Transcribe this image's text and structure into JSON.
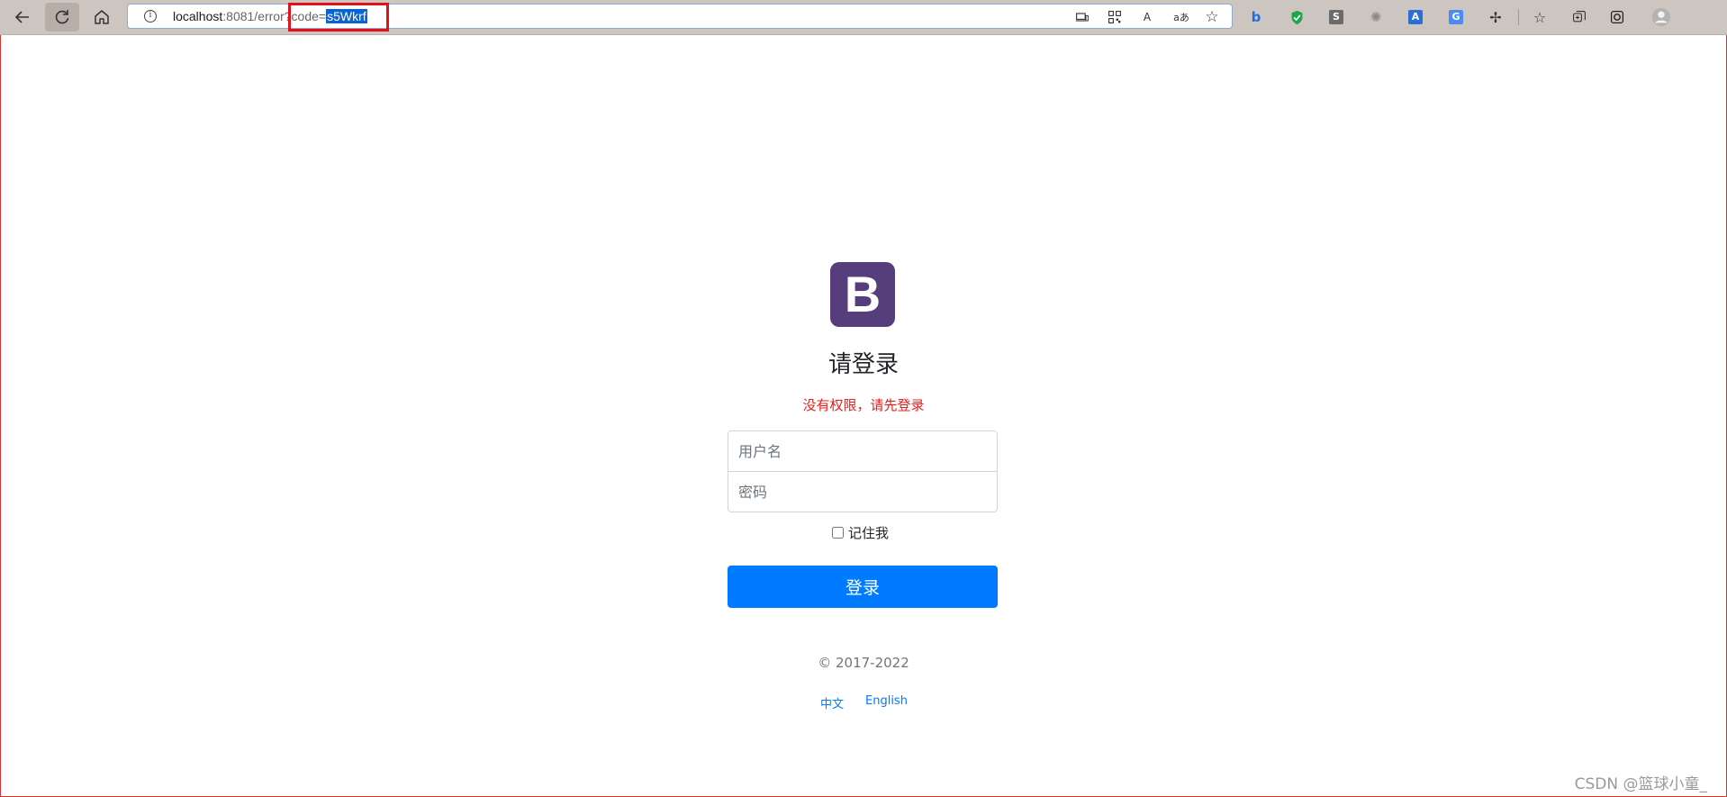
{
  "browser": {
    "url_host": "localhost",
    "url_path": ":8081/error?",
    "url_param": "code=",
    "url_selected": "s5Wkrf",
    "info_glyph": "i",
    "toolbar_icons": [
      "back-icon",
      "refresh-icon",
      "home-icon"
    ],
    "addressbar_icons": [
      "app-available-icon",
      "qr-code-icon",
      "read-aloud-icon",
      "translate-icon",
      "add-favorite-icon"
    ],
    "read_aloud_glyph": "A",
    "translate_glyph": "aあ",
    "extensions": [
      {
        "name": "bing-icon",
        "glyph": "b",
        "color": "#1b6ee5"
      },
      {
        "name": "shield-extension-icon",
        "glyph": "✓",
        "color": "#1aa84a"
      },
      {
        "name": "s-extension-icon",
        "glyph": "S",
        "color": "#6b6b6b"
      },
      {
        "name": "gear-extension-icon",
        "glyph": "✺",
        "color": "#8a8a8a"
      },
      {
        "name": "translate-extension-icon",
        "glyph": "A",
        "color": "#2a6fd6"
      },
      {
        "name": "google-translate-icon",
        "glyph": "G",
        "color": "#4a8af4"
      },
      {
        "name": "extensions-puzzle-icon",
        "glyph": "✢",
        "color": "#333333"
      }
    ],
    "right_icons": [
      "favorites-icon",
      "collections-icon",
      "edge-icon",
      "profile-icon"
    ],
    "highlight_color": "#e0131b"
  },
  "login": {
    "logo_letter": "B",
    "logo_color": "#563d7c",
    "title": "请登录",
    "error": "没有权限，请先登录",
    "username_placeholder": "用户名",
    "password_placeholder": "密码",
    "remember_label": "记住我",
    "button_label": "登录",
    "button_color": "#007bff",
    "copyright": "© 2017-2022",
    "languages": [
      "中文",
      "English"
    ]
  },
  "watermark": "CSDN @篮球小童_"
}
